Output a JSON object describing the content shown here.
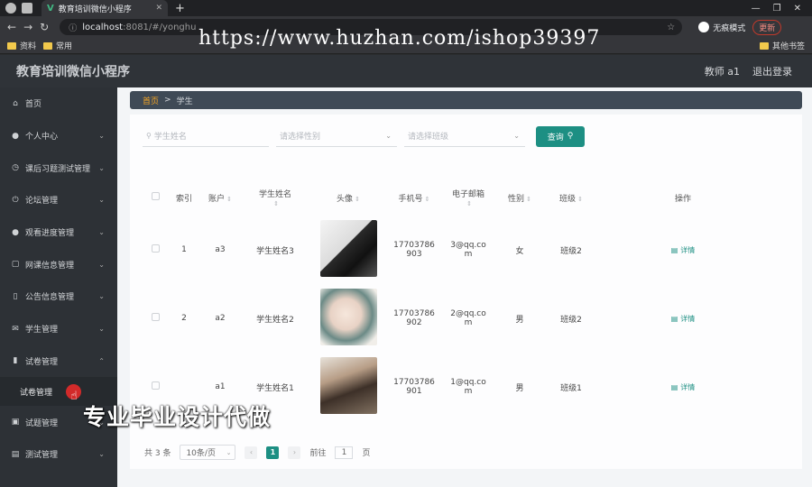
{
  "browser": {
    "tab_title": "教育培训微信小程序",
    "url_host": "localhost",
    "url_path": ":8081/#/yonghu",
    "incognito_label": "无痕模式",
    "update_label": "更新",
    "bookmarks": [
      "资料",
      "常用"
    ],
    "other_bookmarks": "其他书签"
  },
  "watermark": "https://www.huzhan.com/ishop39397",
  "app": {
    "title": "教育培训微信小程序",
    "user": "教师 a1",
    "logout": "退出登录"
  },
  "sidebar": {
    "items": [
      {
        "label": "首页",
        "icon": "home-icon",
        "glyph": "⌂"
      },
      {
        "label": "个人中心",
        "icon": "person-icon",
        "glyph": "●"
      },
      {
        "label": "课后习题测试管理",
        "icon": "clock-icon",
        "glyph": "◷"
      },
      {
        "label": "论坛管理",
        "icon": "power-icon",
        "glyph": "⏻"
      },
      {
        "label": "观看进度管理",
        "icon": "person-icon",
        "glyph": "●"
      },
      {
        "label": "网课信息管理",
        "icon": "frame-icon",
        "glyph": "▢"
      },
      {
        "label": "公告信息管理",
        "icon": "phone-icon",
        "glyph": "▯"
      },
      {
        "label": "学生管理",
        "icon": "mail-icon",
        "glyph": "✉"
      },
      {
        "label": "试卷管理",
        "icon": "chart-icon",
        "glyph": "▮"
      }
    ],
    "submenu": "试卷管理",
    "items_after": [
      {
        "label": "试题管理",
        "icon": "tile-icon",
        "glyph": "▣"
      },
      {
        "label": "测试管理",
        "icon": "doc-icon",
        "glyph": "▤"
      }
    ]
  },
  "breadcrumb": {
    "home": "首页",
    "sep": ">",
    "current": "学生"
  },
  "search": {
    "name_placeholder": "学生姓名",
    "gender_placeholder": "请选择性别",
    "class_placeholder": "请选择班级",
    "query_label": "查询"
  },
  "table": {
    "headers": [
      "索引",
      "账户",
      "学生姓名",
      "头像",
      "手机号",
      "电子邮箱",
      "性别",
      "班级",
      "操作"
    ],
    "rows": [
      {
        "index": "1",
        "account": "a3",
        "name": "学生姓名3",
        "avatar": "av1",
        "phone1": "17703786",
        "phone2": "903",
        "email1": "3@qq.co",
        "email2": "m",
        "gender": "女",
        "class": "班级2",
        "action": "详情"
      },
      {
        "index": "2",
        "account": "a2",
        "name": "学生姓名2",
        "avatar": "av2",
        "phone1": "17703786",
        "phone2": "902",
        "email1": "2@qq.co",
        "email2": "m",
        "gender": "男",
        "class": "班级2",
        "action": "详情"
      },
      {
        "index": "",
        "account": "a1",
        "name": "学生姓名1",
        "avatar": "av3",
        "phone1": "17703786",
        "phone2": "901",
        "email1": "1@qq.co",
        "email2": "m",
        "gender": "男",
        "class": "班级1",
        "action": "详情"
      }
    ]
  },
  "pager": {
    "total": "共 3 条",
    "page_size": "10条/页",
    "current_page": "1",
    "goto_label": "前往",
    "goto_value": "1",
    "page_unit": "页"
  },
  "overlay": "专业毕业设计代做",
  "colors": {
    "accent": "#1d8f83",
    "sidebar": "#2d3136",
    "header": "#2f3338"
  }
}
